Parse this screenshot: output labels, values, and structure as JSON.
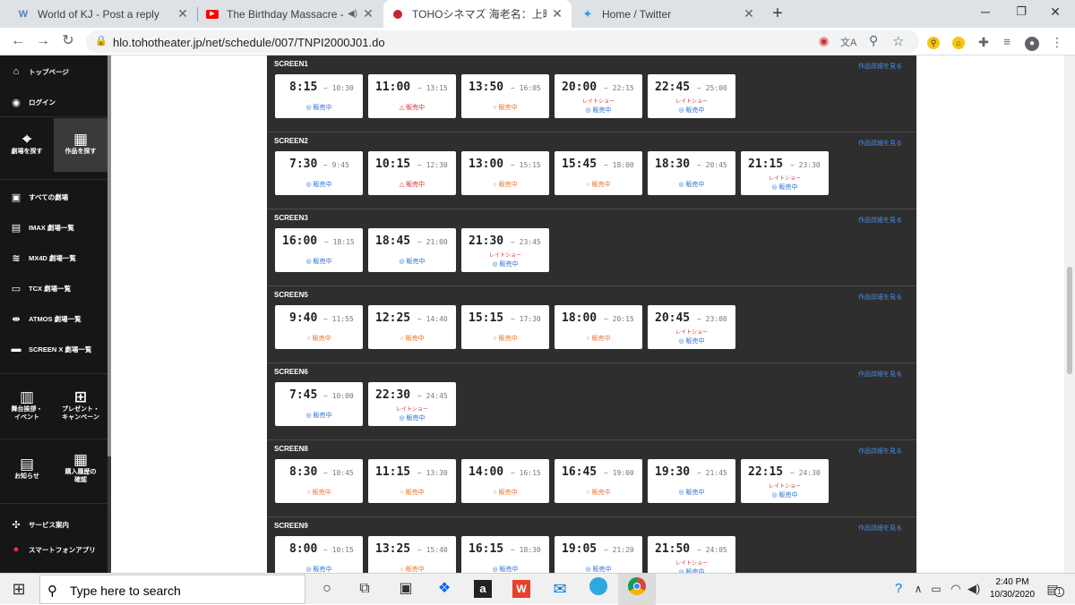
{
  "browser": {
    "tabs": [
      {
        "title": "World of KJ - Post a reply",
        "favicon": "kj-icon",
        "active": false
      },
      {
        "title": "The Birthday Massacre - Sup",
        "favicon": "youtube-icon",
        "active": false,
        "audio": true
      },
      {
        "title": "TOHOシネマズ 海老名：上映スケジ",
        "favicon": "toho-icon",
        "active": true
      },
      {
        "title": "Home / Twitter",
        "favicon": "twitter-icon",
        "active": false
      }
    ],
    "new_tab": "+",
    "url": "hlo.tohotheater.jp/net/schedule/007/TNPI2000J01.do"
  },
  "sidebar": {
    "top_items": [
      {
        "label": "トップページ",
        "icon": "home-icon"
      },
      {
        "label": "ログイン",
        "icon": "user-icon"
      }
    ],
    "grid_top": [
      {
        "label": "劇場を探す",
        "icon": "map-pin-icon",
        "active": false
      },
      {
        "label": "作品を探す",
        "icon": "film-icon",
        "active": true
      }
    ],
    "list_items": [
      {
        "label": "すべての劇場",
        "icon": "theater-icon"
      },
      {
        "label": "IMAX 劇場一覧",
        "icon": "imax-icon"
      },
      {
        "label": "MX4D 劇場一覧",
        "icon": "mx4d-icon"
      },
      {
        "label": "TCX 劇場一覧",
        "icon": "tcx-icon"
      },
      {
        "label": "ATMOS 劇場一覧",
        "icon": "atmos-icon"
      },
      {
        "label": "SCREEN X 劇場一覧",
        "icon": "screenx-icon"
      }
    ],
    "grid_bottom": [
      {
        "label": "舞台挨拶・\nイベント",
        "icon": "calendar-icon"
      },
      {
        "label": "プレゼント・\nキャンペーン",
        "icon": "gift-icon"
      },
      {
        "label": "お知らせ",
        "icon": "news-icon"
      },
      {
        "label": "購入履歴の\n確認",
        "icon": "receipt-icon"
      }
    ],
    "bottom_items": [
      {
        "label": "サービス案内",
        "icon": "service-icon"
      },
      {
        "label": "スマートフォンアプリ",
        "icon": "app-icon"
      }
    ]
  },
  "schedule": {
    "detail_link": "作品詳細を見る",
    "late_show": "レイトショー",
    "on_sale": "販売中",
    "screens": [
      {
        "name": "SCREEN1",
        "shows": [
          {
            "start": "8:15",
            "end": "10:30",
            "mark": "◎",
            "late": false
          },
          {
            "start": "11:00",
            "end": "13:15",
            "mark": "△",
            "late": false
          },
          {
            "start": "13:50",
            "end": "16:05",
            "mark": "○",
            "late": false
          },
          {
            "start": "20:00",
            "end": "22:15",
            "mark": "◎",
            "late": true
          },
          {
            "start": "22:45",
            "end": "25:00",
            "mark": "◎",
            "late": true
          }
        ]
      },
      {
        "name": "SCREEN2",
        "shows": [
          {
            "start": "7:30",
            "end": "9:45",
            "mark": "◎",
            "late": false
          },
          {
            "start": "10:15",
            "end": "12:30",
            "mark": "△",
            "late": false
          },
          {
            "start": "13:00",
            "end": "15:15",
            "mark": "○",
            "late": false
          },
          {
            "start": "15:45",
            "end": "18:00",
            "mark": "○",
            "late": false
          },
          {
            "start": "18:30",
            "end": "20:45",
            "mark": "◎",
            "late": false
          },
          {
            "start": "21:15",
            "end": "23:30",
            "mark": "◎",
            "late": true
          }
        ]
      },
      {
        "name": "SCREEN3",
        "shows": [
          {
            "start": "16:00",
            "end": "18:15",
            "mark": "◎",
            "late": false
          },
          {
            "start": "18:45",
            "end": "21:00",
            "mark": "◎",
            "late": false
          },
          {
            "start": "21:30",
            "end": "23:45",
            "mark": "◎",
            "late": true
          }
        ]
      },
      {
        "name": "SCREEN5",
        "shows": [
          {
            "start": "9:40",
            "end": "11:55",
            "mark": "○",
            "late": false
          },
          {
            "start": "12:25",
            "end": "14:40",
            "mark": "○",
            "late": false
          },
          {
            "start": "15:15",
            "end": "17:30",
            "mark": "○",
            "late": false
          },
          {
            "start": "18:00",
            "end": "20:15",
            "mark": "○",
            "late": false
          },
          {
            "start": "20:45",
            "end": "23:00",
            "mark": "◎",
            "late": true
          }
        ]
      },
      {
        "name": "SCREEN6",
        "shows": [
          {
            "start": "7:45",
            "end": "10:00",
            "mark": "◎",
            "late": false
          },
          {
            "start": "22:30",
            "end": "24:45",
            "mark": "◎",
            "late": true
          }
        ]
      },
      {
        "name": "SCREEN8",
        "shows": [
          {
            "start": "8:30",
            "end": "10:45",
            "mark": "○",
            "late": false
          },
          {
            "start": "11:15",
            "end": "13:30",
            "mark": "○",
            "late": false
          },
          {
            "start": "14:00",
            "end": "16:15",
            "mark": "○",
            "late": false
          },
          {
            "start": "16:45",
            "end": "19:00",
            "mark": "○",
            "late": false
          },
          {
            "start": "19:30",
            "end": "21:45",
            "mark": "◎",
            "late": false
          },
          {
            "start": "22:15",
            "end": "24:30",
            "mark": "◎",
            "late": true
          }
        ]
      },
      {
        "name": "SCREEN9",
        "shows": [
          {
            "start": "8:00",
            "end": "10:15",
            "mark": "◎",
            "late": false
          },
          {
            "start": "13:25",
            "end": "15:40",
            "mark": "○",
            "late": false
          },
          {
            "start": "16:15",
            "end": "18:30",
            "mark": "◎",
            "late": false
          },
          {
            "start": "19:05",
            "end": "21:20",
            "mark": "◎",
            "late": false
          },
          {
            "start": "21:50",
            "end": "24:05",
            "mark": "◎",
            "late": true
          }
        ]
      }
    ],
    "colors": {
      "◎": "#2f6fd1",
      "○": "#e8712a",
      "△": "#d9302c"
    }
  },
  "taskbar": {
    "search_placeholder": "Type here to search",
    "time": "2:40 PM",
    "date": "10/30/2020",
    "notification_count": "1"
  }
}
